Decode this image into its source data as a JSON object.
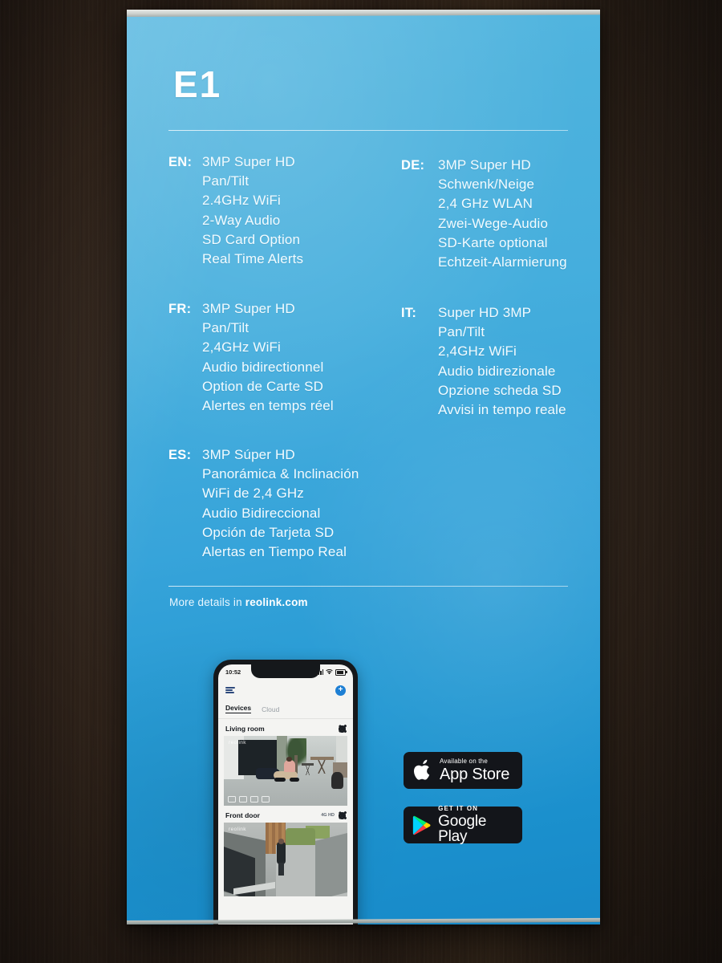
{
  "product": {
    "title": "E1"
  },
  "specs": [
    {
      "code": "EN:",
      "lines": [
        "3MP Super HD",
        "Pan/Tilt",
        "2.4GHz WiFi",
        "2-Way Audio",
        "SD Card Option",
        "Real Time Alerts"
      ]
    },
    {
      "code": "DE:",
      "lines": [
        "3MP Super HD",
        "Schwenk/Neige",
        "2,4 GHz WLAN",
        "Zwei-Wege-Audio",
        "SD-Karte optional",
        "Echtzeit-Alarmierung"
      ]
    },
    {
      "code": "FR:",
      "lines": [
        "3MP Super HD",
        "Pan/Tilt",
        "2,4GHz WiFi",
        "Audio bidirectionnel",
        "Option de Carte SD",
        "Alertes en temps réel"
      ]
    },
    {
      "code": "IT:",
      "lines": [
        "Super HD 3MP",
        "Pan/Tilt",
        "2,4GHz WiFi",
        "Audio bidirezionale",
        "Opzione scheda SD",
        "Avvisi in tempo reale"
      ]
    },
    {
      "code": "ES:",
      "lines": [
        "3MP Súper HD",
        "Panorámica & Inclinación",
        "WiFi de 2,4 GHz",
        "Audio Bidireccional",
        "Opción de Tarjeta SD",
        "Alertas en Tiempo Real"
      ]
    }
  ],
  "footer": {
    "more_details_prefix": "More details in ",
    "website": "reolink.com"
  },
  "badges": {
    "app_store": {
      "small": "Available on the",
      "large": "App Store",
      "icon": "apple-logo-icon"
    },
    "google_play": {
      "small": "GET IT ON",
      "large": "Google Play",
      "icon": "google-play-triangle-icon"
    }
  },
  "phone": {
    "status": {
      "time": "10:52",
      "signal": "signal-bars-icon",
      "wifi": "wifi-icon",
      "battery": "battery-icon"
    },
    "nav": {
      "menu": "hamburger-menu-icon",
      "add": "+"
    },
    "tabs": [
      {
        "label": "Devices",
        "active": true
      },
      {
        "label": "Cloud",
        "active": false
      }
    ],
    "devices": [
      {
        "name": "Living room",
        "settings_icon": "gear-icon",
        "badge": ""
      },
      {
        "name": "Front door",
        "settings_icon": "gear-icon",
        "badge": "4G HD"
      }
    ],
    "watermark": "reolink"
  },
  "colors": {
    "box_blue_top": "#55b7e0",
    "box_blue_bottom": "#1789c8",
    "text_white": "#f2fbff",
    "badge_black": "#13151a",
    "wood_brown": "#2e2219"
  }
}
